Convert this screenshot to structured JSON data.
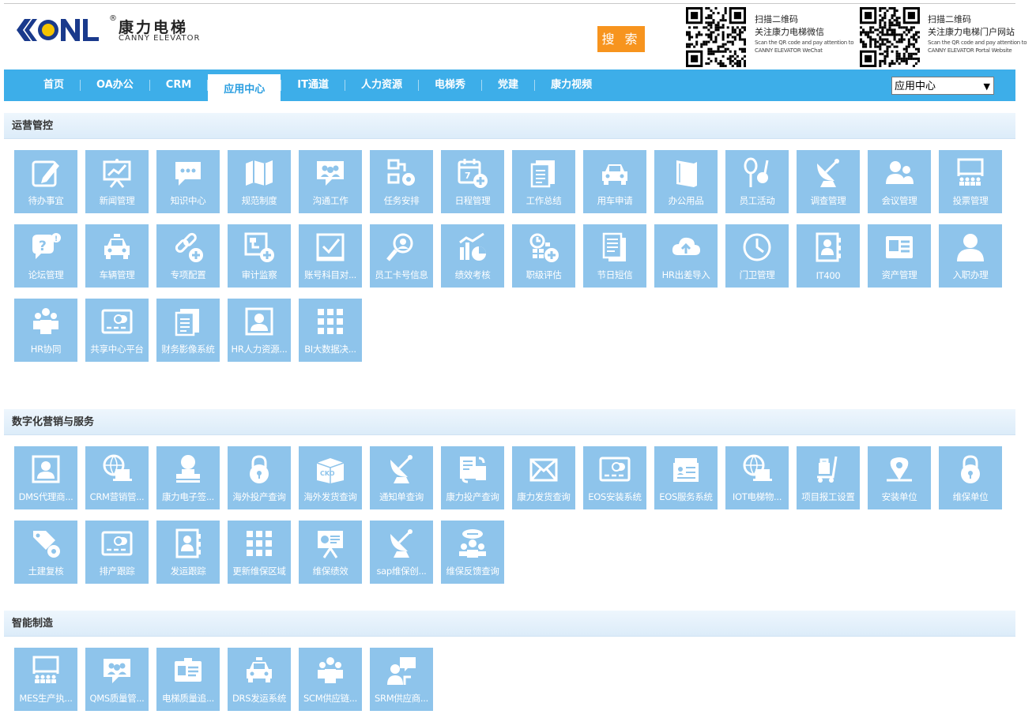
{
  "brand": {
    "mark": "KONL",
    "name_cn": "康力电梯",
    "name_en": "CANNY ELEVATOR",
    "registered": "®"
  },
  "search": {
    "label": "搜 索"
  },
  "qr_codes": [
    {
      "line1": "扫描二维码",
      "line2": "关注康力电梯微信",
      "en1": "Scan the QR code and pay attention to",
      "en2": "CANNY ELEVATOR WeChat"
    },
    {
      "line1": "扫描二维码",
      "line2": "关注康力电梯门户网站",
      "en1": "Scan the QR code and pay attention to",
      "en2": "CANNY ELEVATOR Portal Website"
    }
  ],
  "nav": {
    "items": [
      "首页",
      "OA办公",
      "CRM",
      "应用中心",
      "IT通道",
      "人力资源",
      "电梯秀",
      "党建",
      "康力视频"
    ],
    "active": "应用中心",
    "select_value": "应用中心"
  },
  "colors": {
    "nav": "#3daee9",
    "tile": "#8ec4eb",
    "search": "#f7941e"
  },
  "sections": [
    {
      "title": "运营管控",
      "tiles": [
        {
          "label": "待办事宜",
          "icon": "edit-icon"
        },
        {
          "label": "新闻管理",
          "icon": "presentation-chart-icon"
        },
        {
          "label": "知识中心",
          "icon": "chat-bubble-icon"
        },
        {
          "label": "规范制度",
          "icon": "map-icon"
        },
        {
          "label": "沟通工作",
          "icon": "group-chat-icon"
        },
        {
          "label": "任务安排",
          "icon": "workflow-gear-icon"
        },
        {
          "label": "日程管理",
          "icon": "calendar-add-icon"
        },
        {
          "label": "工作总结",
          "icon": "documents-icon"
        },
        {
          "label": "用车申请",
          "icon": "car-icon"
        },
        {
          "label": "办公用品",
          "icon": "book-icon"
        },
        {
          "label": "员工活动",
          "icon": "racket-ball-icon"
        },
        {
          "label": "调查管理",
          "icon": "satellite-dish-icon"
        },
        {
          "label": "会议管理",
          "icon": "people-icon"
        },
        {
          "label": "投票管理",
          "icon": "audience-screen-icon"
        },
        {
          "label": "论坛管理",
          "icon": "question-chat-icon"
        },
        {
          "label": "车辆管理",
          "icon": "taxi-icon"
        },
        {
          "label": "专项配置",
          "icon": "link-add-icon"
        },
        {
          "label": "审计监察",
          "icon": "flow-add-icon"
        },
        {
          "label": "账号科目对...",
          "icon": "checkbox-icon"
        },
        {
          "label": "员工卡号信息",
          "icon": "user-search-icon"
        },
        {
          "label": "绩效考核",
          "icon": "bar-pie-chart-icon"
        },
        {
          "label": "职级评估",
          "icon": "calculator-add-icon"
        },
        {
          "label": "节日短信",
          "icon": "document-copy-icon"
        },
        {
          "label": "HR出差导入",
          "icon": "cloud-upload-icon"
        },
        {
          "label": "门卫管理",
          "icon": "clock-icon"
        },
        {
          "label": "IT400",
          "icon": "contact-book-icon"
        },
        {
          "label": "资产管理",
          "icon": "id-card-icon"
        },
        {
          "label": "入职办理",
          "icon": "user-icon"
        },
        {
          "label": "HR协同",
          "icon": "team-icon"
        },
        {
          "label": "共享中心平台",
          "icon": "card-toggle-icon"
        },
        {
          "label": "财务影像系统",
          "icon": "documents-icon"
        },
        {
          "label": "HR人力资源...",
          "icon": "user-portrait-icon"
        },
        {
          "label": "BI大数据决...",
          "icon": "grid-icon"
        }
      ]
    },
    {
      "title": "数字化营销与服务",
      "tiles": [
        {
          "label": "DMS代理商...",
          "icon": "user-portrait-icon"
        },
        {
          "label": "CRM营销管...",
          "icon": "globe-laptop-icon"
        },
        {
          "label": "康力电子签...",
          "icon": "stamp-icon"
        },
        {
          "label": "海外投产查询",
          "icon": "lock-icon"
        },
        {
          "label": "海外发货查询",
          "icon": "box-icon"
        },
        {
          "label": "通知单查询",
          "icon": "satellite-dish-icon"
        },
        {
          "label": "康力投产查询",
          "icon": "document-sync-icon"
        },
        {
          "label": "康力发货查询",
          "icon": "mail-box-icon"
        },
        {
          "label": "EOS安装系统",
          "icon": "card-toggle-icon"
        },
        {
          "label": "EOS服务系统",
          "icon": "register-icon"
        },
        {
          "label": "IOT电梯物...",
          "icon": "globe-laptop-icon"
        },
        {
          "label": "项目报工设置",
          "icon": "luggage-cart-icon"
        },
        {
          "label": "安装单位",
          "icon": "location-pin-icon"
        },
        {
          "label": "维保单位",
          "icon": "lock-icon"
        },
        {
          "label": "土建复核",
          "icon": "tag-gear-icon"
        },
        {
          "label": "排产跟踪",
          "icon": "card-toggle-icon"
        },
        {
          "label": "发运跟踪",
          "icon": "contact-book-icon"
        },
        {
          "label": "更新维保区域",
          "icon": "grid-icon"
        },
        {
          "label": "维保绩效",
          "icon": "board-chart-icon"
        },
        {
          "label": "sap维保创...",
          "icon": "satellite-dish-icon"
        },
        {
          "label": "维保反馈查询",
          "icon": "feedback-group-icon"
        }
      ]
    },
    {
      "title": "智能制造",
      "tiles": [
        {
          "label": "MES生产执...",
          "icon": "audience-screen-icon"
        },
        {
          "label": "QMS质量管...",
          "icon": "group-chat-icon"
        },
        {
          "label": "电梯质量追...",
          "icon": "badge-card-icon"
        },
        {
          "label": "DRS发运系统",
          "icon": "taxi-icon"
        },
        {
          "label": "SCM供应链...",
          "icon": "team-icon"
        },
        {
          "label": "SRM供应商...",
          "icon": "speaker-chat-icon"
        }
      ]
    }
  ]
}
